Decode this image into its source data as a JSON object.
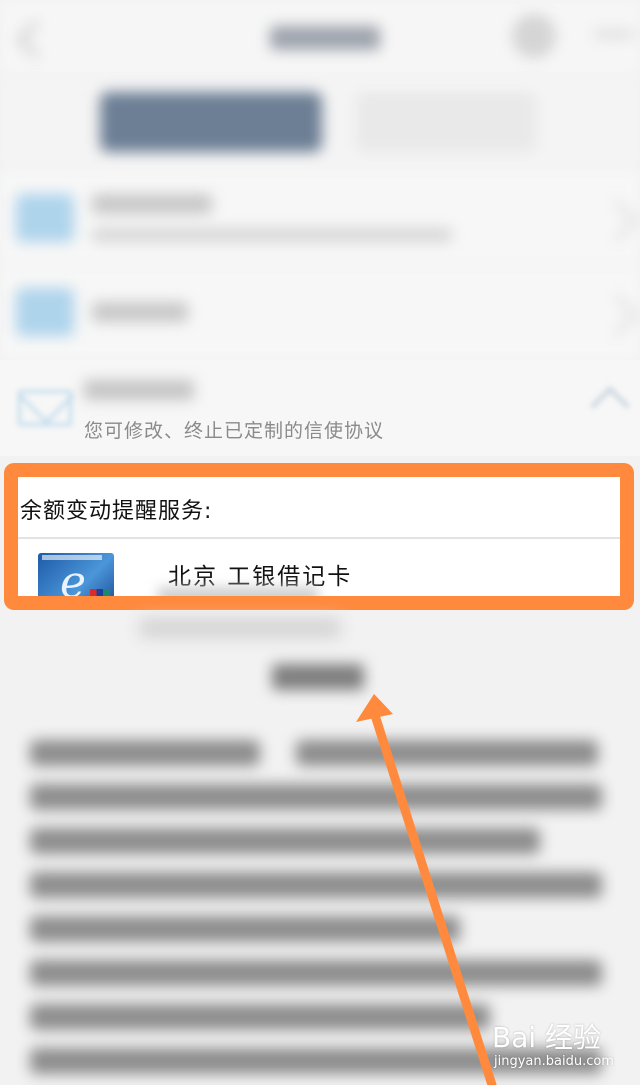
{
  "row3": {
    "subtitle": "您可修改、终止已定制的信使协议"
  },
  "balance_section": {
    "title": "余额变动提醒服务:",
    "card": {
      "name": "北京 工银借记卡",
      "thumbnail_icon": "icbc-e-card-thumbnail"
    }
  },
  "watermark": {
    "main": "Bai 经验",
    "sub": "jingyan.baidu.com"
  },
  "annotation": {
    "highlight_color": "#ff8a3d",
    "arrow_color": "#ff8a3d"
  }
}
